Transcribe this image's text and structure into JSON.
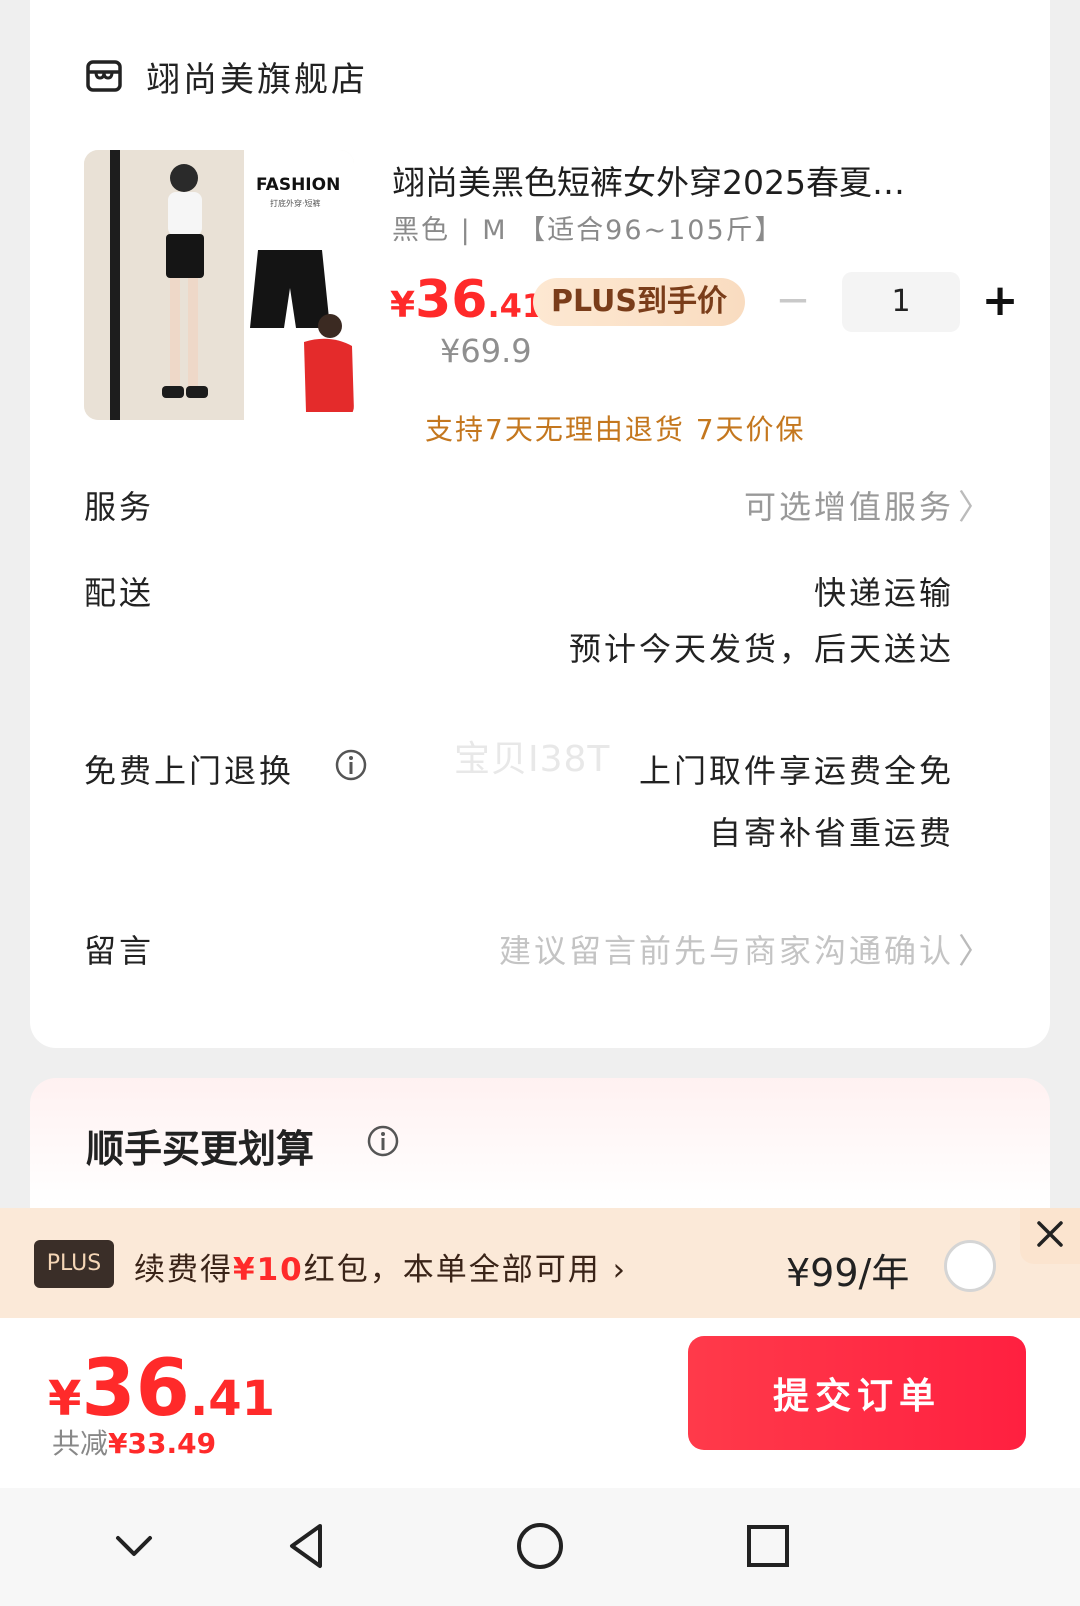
{
  "store": {
    "name": "翊尚美旗舰店",
    "icon": "store-icon"
  },
  "product": {
    "title": "翊尚美黑色短裤女外穿2025春夏…",
    "spec": "黑色 | M 【适合96~105斤】",
    "price_symbol": "¥",
    "price_int": "36",
    "price_dec": ".41",
    "plus_label": "PLUS到手价",
    "original_price": "¥69.9",
    "quantity": "1",
    "minus": "−",
    "plus": "+",
    "guarantee": "支持7天无理由退货  7天价保",
    "image_text": "FASHION",
    "image_subtext": "打底外穿·短裤"
  },
  "rows": {
    "service_label": "服务",
    "service_value": "可选增值服务",
    "delivery_label": "配送",
    "delivery_value_1": "快递运输",
    "delivery_value_2": "预计今天发货，后天送达",
    "return_label": "免费上门退换",
    "return_value_1": "上门取件享运费全免",
    "return_value_2": "自寄补省重运费",
    "message_label": "留言",
    "message_placeholder": "建议留言前先与商家沟通确认",
    "chevron": "〉"
  },
  "watermark": "宝贝I38T",
  "addon": {
    "heading": "顺手买更划算"
  },
  "plus_bar": {
    "tag": "PLUS",
    "text_prefix": "续费得",
    "text_red": "¥10",
    "text_suffix": "红包，本单全部可用 ›",
    "price": "¥99/年",
    "close": "×"
  },
  "footer": {
    "total_symbol": "¥",
    "total_int": "36",
    "total_dec": ".41",
    "saving_prefix": "共减",
    "saving_value": "¥33.49",
    "submit": "提交订单"
  },
  "colors": {
    "accent": "#ff2a2a",
    "guarantee": "#c4771e",
    "plus_bar": "#fbe9d8"
  }
}
